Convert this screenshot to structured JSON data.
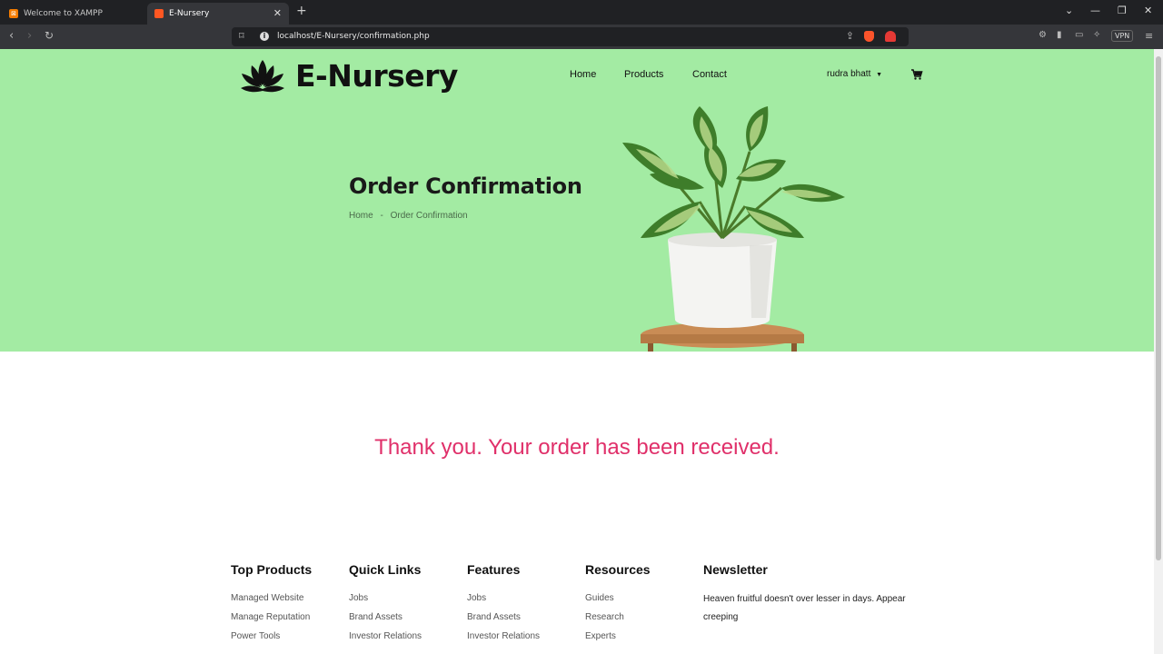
{
  "browser": {
    "tabs": [
      {
        "title": "Welcome to XAMPP",
        "active": false
      },
      {
        "title": "E-Nursery",
        "active": true
      }
    ],
    "url": "localhost/E-Nursery/confirmation.php",
    "vpn_label": "VPN"
  },
  "header": {
    "brand": "E-Nursery",
    "nav": [
      "Home",
      "Products",
      "Contact"
    ],
    "user": "rudra bhatt"
  },
  "hero": {
    "title": "Order Confirmation",
    "breadcrumb": [
      "Home",
      "Order Confirmation"
    ],
    "breadcrumb_sep": "-",
    "background_color": "#a3eba3"
  },
  "confirmation": {
    "message": "Thank you. Your order has been received.",
    "color": "#e0306a"
  },
  "footer": {
    "columns": [
      {
        "heading": "Top Products",
        "links": [
          "Managed Website",
          "Manage Reputation",
          "Power Tools"
        ]
      },
      {
        "heading": "Quick Links",
        "links": [
          "Jobs",
          "Brand Assets",
          "Investor Relations"
        ]
      },
      {
        "heading": "Features",
        "links": [
          "Jobs",
          "Brand Assets",
          "Investor Relations"
        ]
      },
      {
        "heading": "Resources",
        "links": [
          "Guides",
          "Research",
          "Experts"
        ]
      }
    ],
    "newsletter": {
      "heading": "Newsletter",
      "text": "Heaven fruitful doesn't over lesser in days. Appear creeping"
    }
  }
}
